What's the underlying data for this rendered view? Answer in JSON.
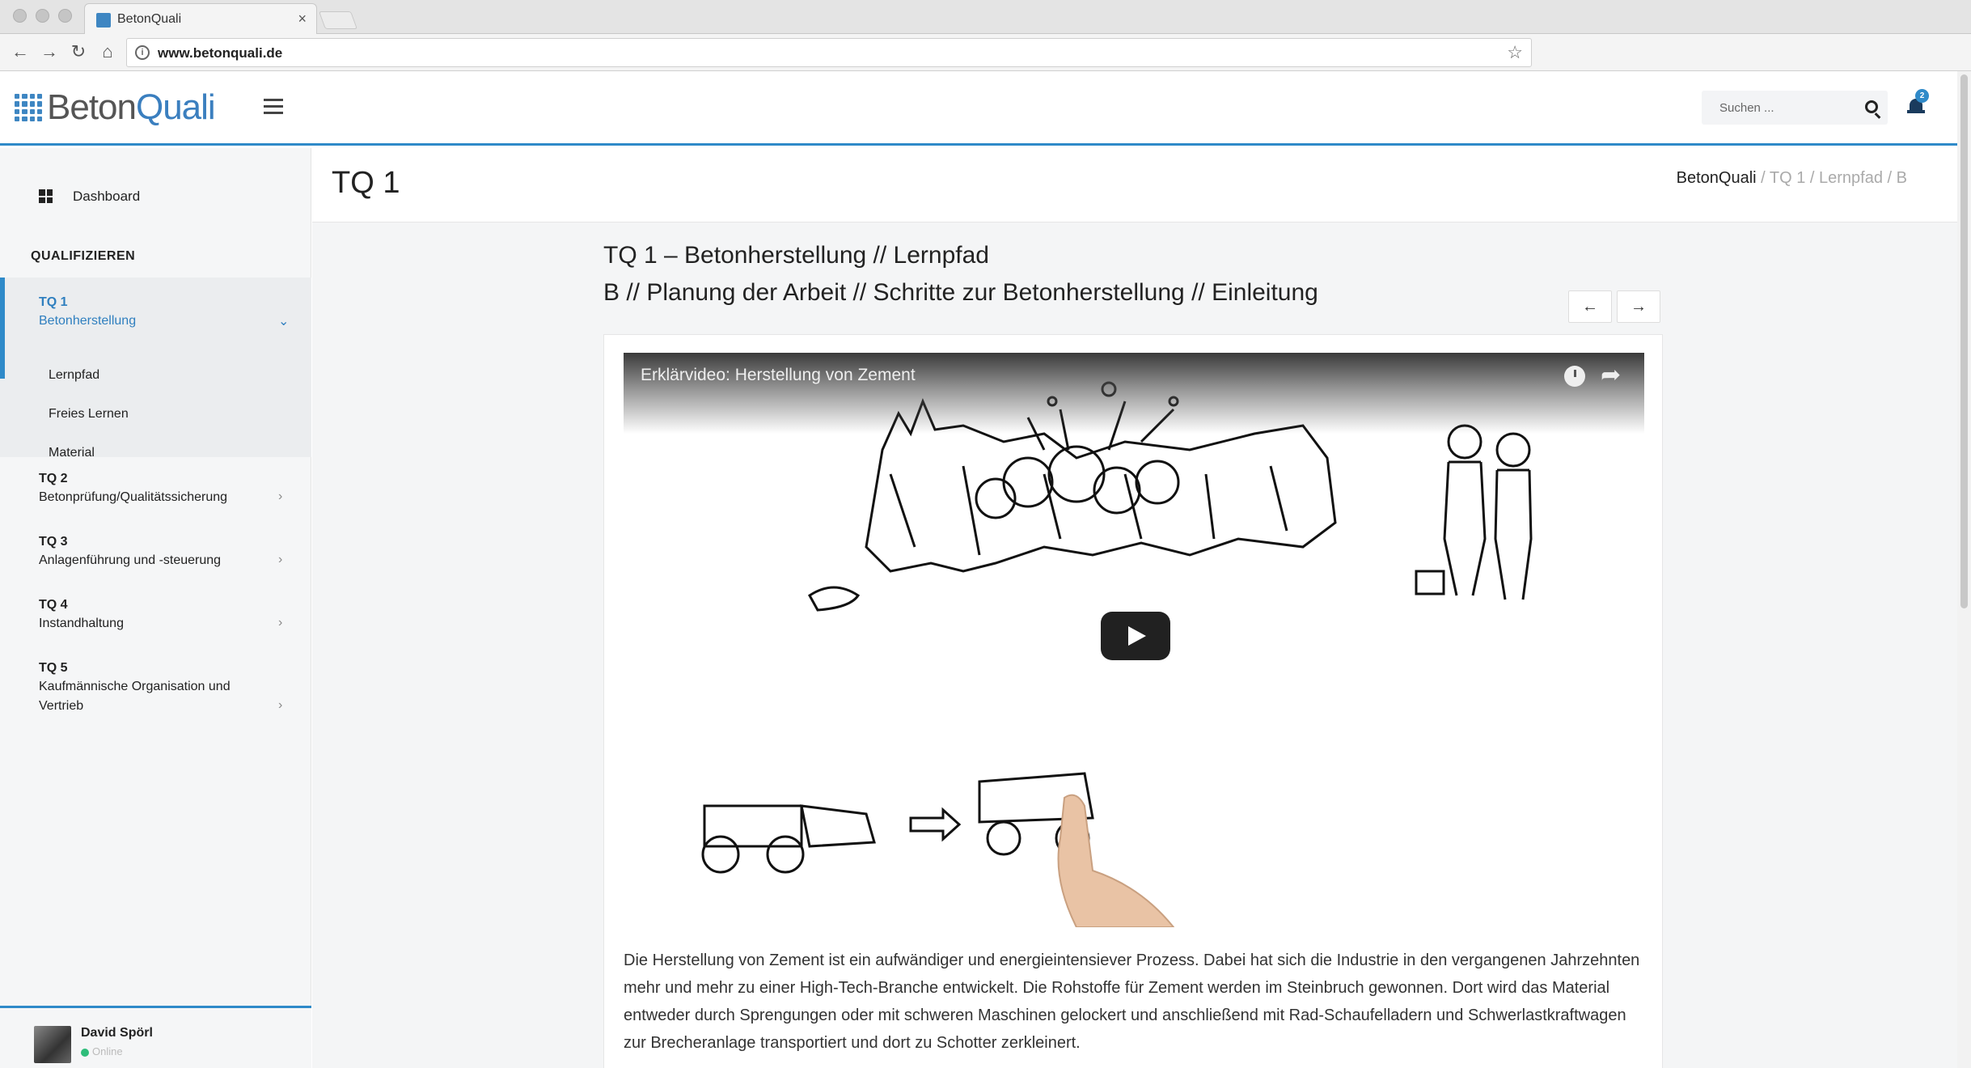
{
  "browser": {
    "tab_title": "BetonQuali",
    "tab_close": "×",
    "url": "www.betonquali.de"
  },
  "header": {
    "logo_beton": "Beton",
    "logo_quali": "Quali",
    "search_placeholder": "Suchen ...",
    "notification_count": "2"
  },
  "sidebar": {
    "dashboard_label": "Dashboard",
    "section_title": "QUALIFIZIEREN",
    "items": [
      {
        "code": "TQ 1",
        "label": "Betonherstellung",
        "expanded": true,
        "subitems": [
          "Lernpfad",
          "Freies Lernen",
          "Material"
        ]
      },
      {
        "code": "TQ 2",
        "label": "Betonprüfung/Qualitätssicherung"
      },
      {
        "code": "TQ 3",
        "label": "Anlagenführung und -steuerung"
      },
      {
        "code": "TQ 4",
        "label": "Instandhaltung"
      },
      {
        "code": "TQ 5",
        "label_line1": "Kaufmännische Organisation und",
        "label_line2": "Vertrieb"
      }
    ],
    "user": {
      "name": "David Spörl",
      "status": "Online"
    }
  },
  "main": {
    "page_title": "TQ 1",
    "breadcrumb": {
      "home": "BetonQuali",
      "rest": " / TQ 1 / Lernpfad / B"
    },
    "content_title_line1": "TQ 1 – Betonherstellung // Lernpfad",
    "content_title_line2": "B // Planung der Arbeit // Schritte zur Betonherstellung // Einleitung",
    "prev_label": "←",
    "next_label": "→",
    "video_title": "Erklärvideo: Herstellung von Zement",
    "description": "Die Herstellung von Zement ist ein aufwändiger und energieintensiever Prozess. Dabei hat sich die Industrie in den vergangenen Jahrzehnten mehr und mehr zu einer High-Tech-Branche entwickelt. Die Rohstoffe für Zement werden im Steinbruch gewonnen. Dort wird das Material entweder durch Sprengungen oder mit schweren Maschinen gelockert und anschließend mit Rad-Schaufelladern und Schwerlastkraftwagen zur Brecheranlage transportiert und dort zu Schotter zerkleinert."
  },
  "colors": {
    "accent": "#2f8ac9",
    "active_text": "#2f7fbf",
    "online": "#2ebd7a"
  }
}
